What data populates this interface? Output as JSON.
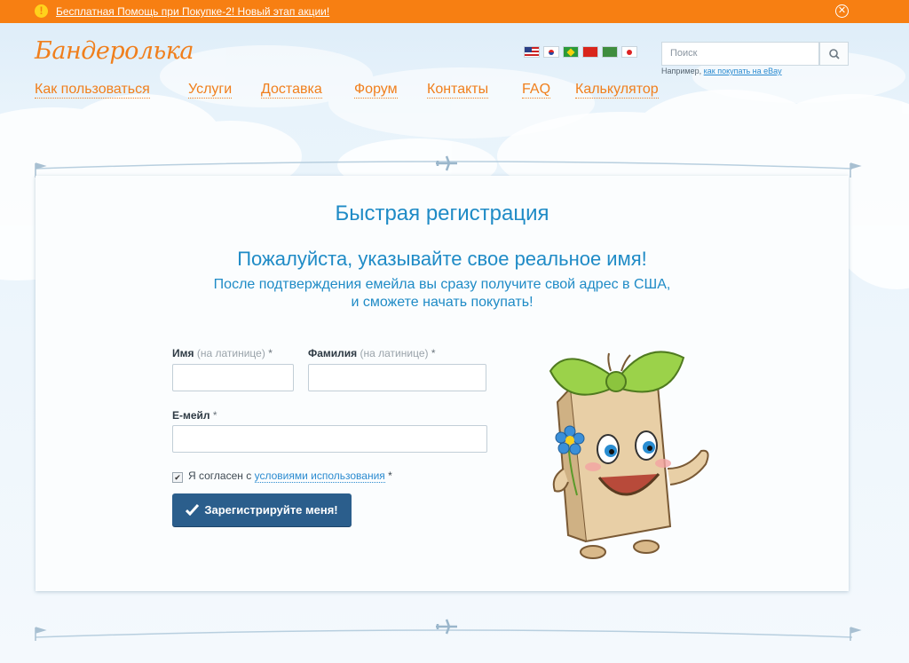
{
  "promo": {
    "text": "Бесплатная Помощь при Покупке-2! Новый этап акции!",
    "warn_icon": "!",
    "close_icon": "✕"
  },
  "logo": "Бандеролька",
  "languages": [
    "English",
    "Korean",
    "Portuguese",
    "Chinese",
    "Arabic",
    "Japanese"
  ],
  "search": {
    "placeholder": "Поиск",
    "hint_prefix": "Например,",
    "hint_link": "как покупать на eBay"
  },
  "nav": [
    "Как пользоваться",
    "Услуги",
    "Доставка",
    "Форум",
    "Контакты",
    "FAQ",
    "Калькулятор"
  ],
  "form": {
    "title": "Быстрая регистрация",
    "heading": "Пожалуйста, указывайте свое реальное имя!",
    "subtitle_line1": "После подтверждения емейла вы сразу получите свой адрес в США,",
    "subtitle_line2": "и сможете начать покупать!",
    "first_name_label": "Имя",
    "first_name_hint": "(на латинице)",
    "last_name_label": "Фамилия",
    "last_name_hint": "(на латинице)",
    "email_label": "Е-мейл",
    "required_mark": "*",
    "first_name_value": "",
    "last_name_value": "",
    "email_value": "",
    "agree_prefix": "Я согласен с",
    "agree_link": "условиями использования",
    "agree_checked": true,
    "submit_label": "Зарегистрируйте меня!"
  },
  "colors": {
    "promo": "#f77f12",
    "accent": "#f07f1c",
    "heading": "#1f8bc6",
    "button": "#2b5e8c"
  }
}
